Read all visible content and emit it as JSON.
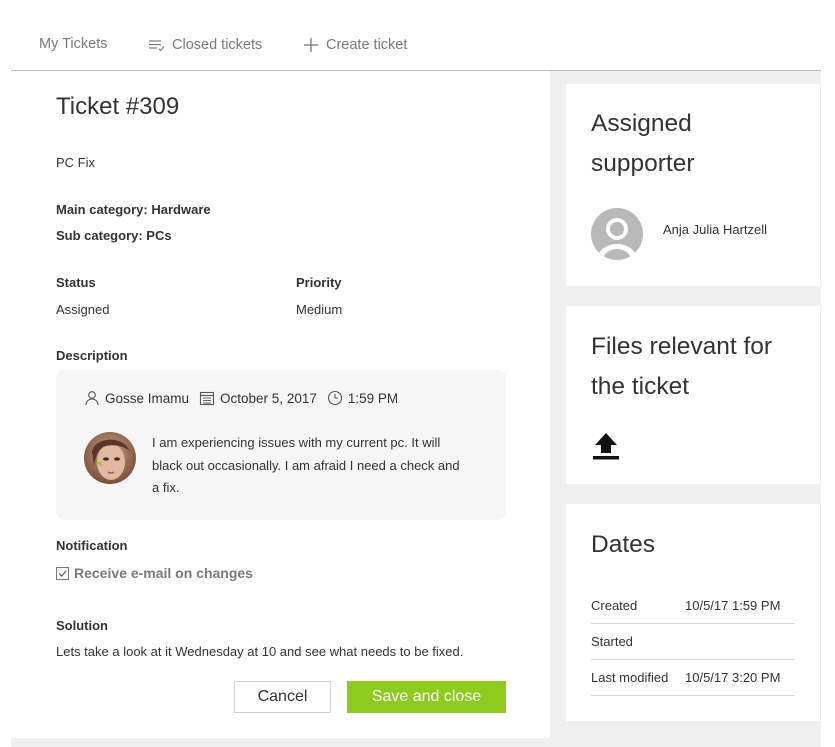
{
  "nav": {
    "my_tickets": "My Tickets",
    "closed_tickets": "Closed tickets",
    "create_ticket": "Create ticket"
  },
  "ticket": {
    "title": "Ticket #309",
    "subject": "PC Fix",
    "main_category": "Main category: Hardware",
    "sub_category": "Sub category: PCs",
    "status_label": "Status",
    "status_value": "Assigned",
    "priority_label": "Priority",
    "priority_value": "Medium",
    "description_label": "Description",
    "description": {
      "author": "Gosse Imamu",
      "date": "October 5, 2017",
      "time": "1:59 PM",
      "text": "I am experiencing issues with my current pc. It will black out occasionally. I am afraid I need a check and a fix."
    },
    "notification_label": "Notification",
    "notification_checkbox": "Receive e-mail on changes",
    "solution_label": "Solution",
    "solution_text": "Lets take a look at it Wednesday at 10 and see what needs to be fixed."
  },
  "buttons": {
    "cancel": "Cancel",
    "save": "Save and close"
  },
  "sidebar": {
    "assigned_title": "Assigned supporter",
    "supporter_name": "Anja Julia Hartzell",
    "files_title": "Files relevant for the ticket",
    "dates_title": "Dates",
    "dates": [
      {
        "label": "Created",
        "value": "10/5/17  1:59 PM"
      },
      {
        "label": "Started",
        "value": ""
      },
      {
        "label": "Last modified",
        "value": "10/5/17  3:20 PM"
      }
    ]
  },
  "colors": {
    "accent_green": "#8dcb1f",
    "panel_bg": "#efefef",
    "nav_text": "#7a7a7a"
  },
  "icons": {
    "closed_tickets": "list-icon",
    "create_ticket": "plus-icon",
    "author": "person-icon",
    "date": "calendar-icon",
    "time": "clock-icon",
    "upload": "upload-icon"
  }
}
